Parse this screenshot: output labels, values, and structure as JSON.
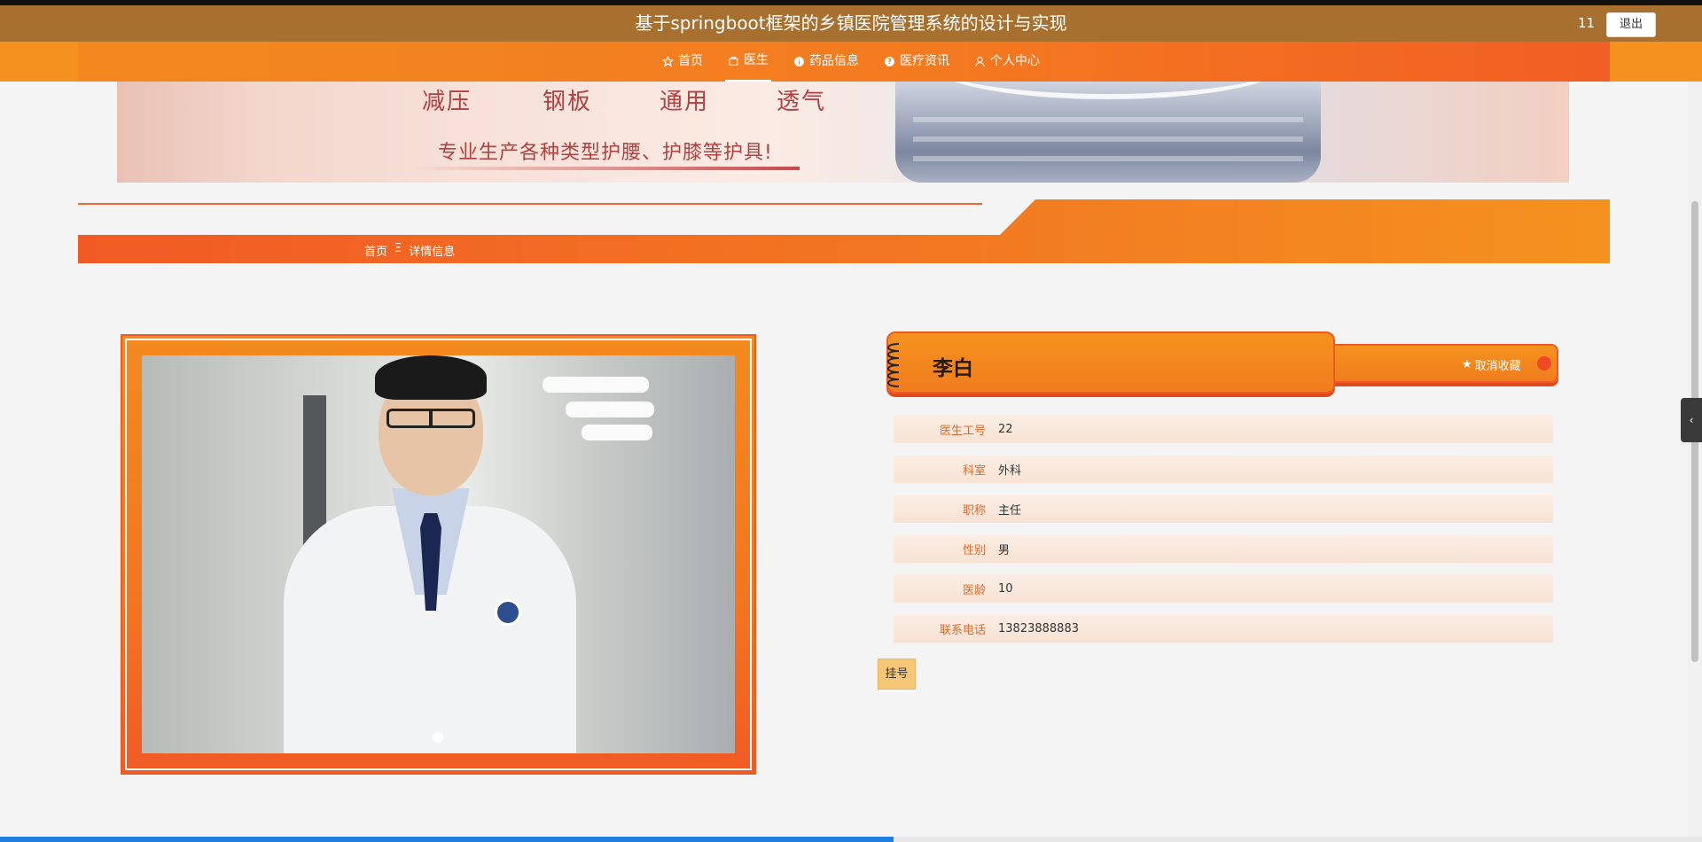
{
  "header": {
    "title": "基于springboot框架的乡镇医院管理系统的设计与实现",
    "user": "11",
    "logout_label": "退出"
  },
  "nav": {
    "items": [
      {
        "label": "首页",
        "icon": "star-icon"
      },
      {
        "label": "医生",
        "icon": "bag-icon"
      },
      {
        "label": "药品信息",
        "icon": "info-icon"
      },
      {
        "label": "医疗资讯",
        "icon": "question-icon"
      },
      {
        "label": "个人中心",
        "icon": "person-icon"
      }
    ],
    "active_index": 1
  },
  "banner": {
    "features": [
      "减压",
      "钢板",
      "通用",
      "透气"
    ],
    "slogan": "专业生产各种类型护腰、护膝等护具!"
  },
  "breadcrumb": {
    "home": "首页",
    "separator": "Ξ",
    "current": "详情信息"
  },
  "doctor": {
    "name": "李白",
    "favorite_label": "取消收藏",
    "fields": [
      {
        "label": "医生工号",
        "value": "22"
      },
      {
        "label": "科室",
        "value": "外科"
      },
      {
        "label": "职称",
        "value": "主任"
      },
      {
        "label": "性别",
        "value": "男"
      },
      {
        "label": "医龄",
        "value": "10"
      },
      {
        "label": "联系电话",
        "value": "13823888883"
      }
    ],
    "register_label": "挂号"
  },
  "colors": {
    "header_bg": "#a8702f",
    "nav_start": "#f28a1f",
    "nav_end": "#f15a24",
    "label_color": "#e26a2c",
    "register_bg": "#f5c776"
  },
  "page_load_progress": 0.525
}
